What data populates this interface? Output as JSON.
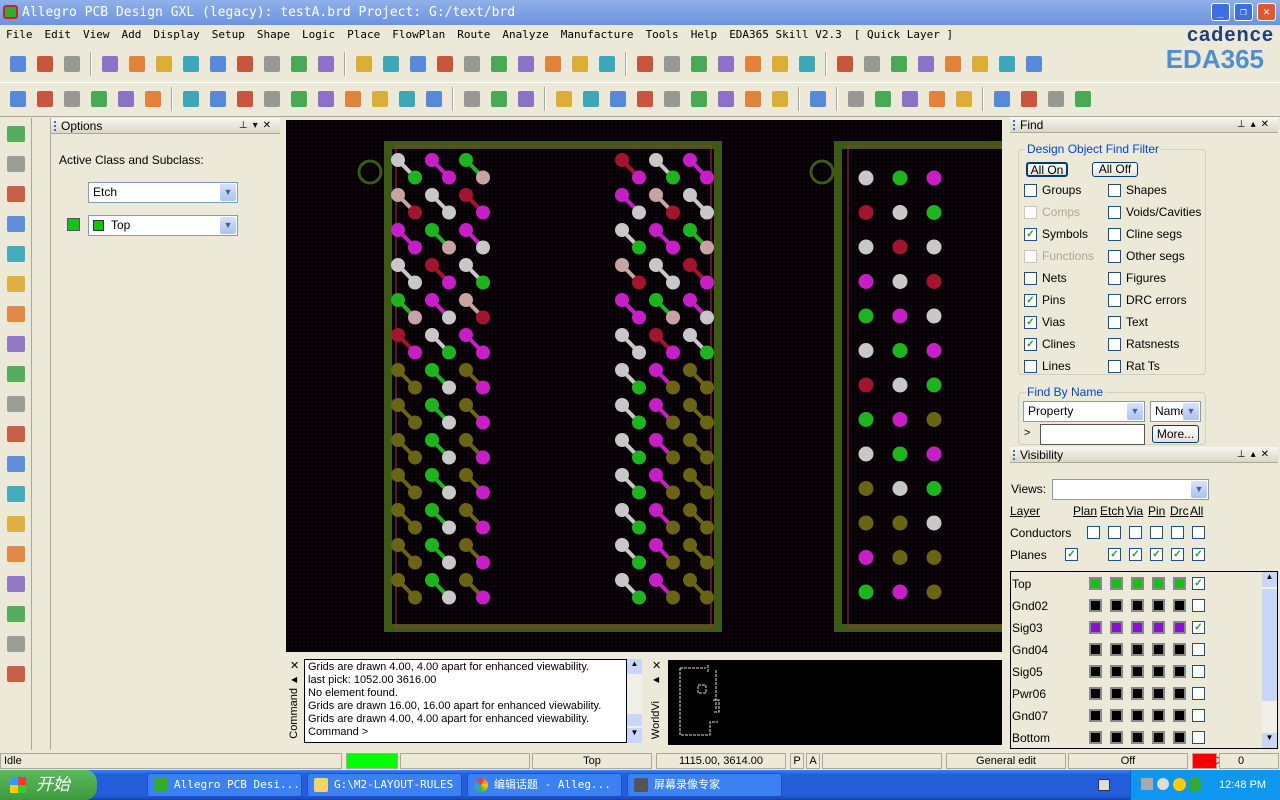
{
  "window": {
    "title": "Allegro PCB Design GXL (legacy): testA.brd  Project: G:/text/brd",
    "minimize": "_",
    "maximize": "❐",
    "close": "✕"
  },
  "brand": {
    "line1": "cadence",
    "line2": "EDA365"
  },
  "menu": [
    "File",
    "Edit",
    "View",
    "Add",
    "Display",
    "Setup",
    "Shape",
    "Logic",
    "Place",
    "FlowPlan",
    "Route",
    "Analyze",
    "Manufacture",
    "Tools",
    "Help",
    "EDA365 Skill V2.3",
    "[ Quick Layer ]"
  ],
  "toolbar1": [
    "new-icon",
    "open-icon",
    "save-icon",
    "|",
    "move-icon",
    "copy-icon",
    "delete-icon",
    "undo-icon",
    "down-arrow-icon",
    "redo-icon",
    "down-arrow-icon",
    "ratsnest-icon",
    "pin-icon",
    "|",
    "grid-icon",
    "zoom-fit-icon",
    "zoom-window-icon",
    "zoom-in-icon",
    "zoom-out-icon",
    "zoom-prev-icon",
    "zoom-world-icon",
    "refresh-icon",
    "3d-view-icon",
    "flip-icon",
    "|",
    "grid-toggle-icon",
    "color-icon",
    "layer-icon",
    "stack-icon",
    "ecset-icon",
    "dfa-icon",
    "spread-icon",
    "|",
    "info-icon",
    "property-icon",
    "measure-icon",
    "highlight-icon",
    "sun-icon",
    "dehighlight-icon",
    "report-icon",
    "erase-icon"
  ],
  "toolbar2": [
    "place-icon-1",
    "place-icon-2",
    "place-icon-3",
    "place-icon-4",
    "place-icon-5",
    "place-icon-6",
    "|",
    "add-connect-icon",
    "rect-icon",
    "circle-icon",
    "select-icon",
    "shape-icon",
    "arc-icon",
    "square-icon",
    "circle2-icon",
    "void-icon",
    "shape-edit-icon",
    "|",
    "component-icon",
    "dimension-icon",
    "dim2-icon",
    "|",
    "odb-icon",
    "film-icon",
    "mfg-icon",
    "camera-icon",
    "refdes-icon",
    "legend-icon",
    "drill-icon",
    "dimension3-icon",
    "array-icon",
    "|",
    "route-icon",
    "|",
    "doc1-icon",
    "doc2-icon",
    "doc3-icon",
    "check-icon",
    "wand-icon",
    "|",
    "window-icon",
    "shape-fill-icon",
    "mail-icon",
    "help-icon"
  ],
  "lefttools": [
    "place-manual-icon",
    "place-refdes-icon",
    "swap-icon",
    "add-connect-icon",
    "slide-icon",
    "delay-tune-icon",
    "custom-smooth-icon",
    "vertex-icon",
    "bus-route-icon",
    "fanout-icon",
    "spread-icon",
    "add-line-icon",
    "add-rect-icon",
    "add-text-icon",
    "edit-text-icon",
    "via-route-icon",
    "route-2-icon",
    "delete-route-icon",
    "cleanup-icon"
  ],
  "options": {
    "title": "Options",
    "label": "Active Class and Subclass:",
    "class_value": "Etch",
    "subclass_value": "Top",
    "subclass_color": "#12c412"
  },
  "console": {
    "tab": "Command",
    "lines": [
      "Grids are drawn 4.00, 4.00 apart for enhanced viewability.",
      "last pick:  1052.00  3616.00",
      "No element found.",
      "Grids are drawn 16.00, 16.00 apart for enhanced viewability.",
      "Grids are drawn 4.00, 4.00 apart for enhanced viewability.",
      "Command >"
    ]
  },
  "worldview": {
    "tab": "WorldVi"
  },
  "find": {
    "title": "Find",
    "filter_legend": "Design Object Find Filter",
    "all_on": "All On",
    "all_off": "All Off",
    "left": [
      {
        "label": "Groups",
        "checked": false,
        "disabled": false
      },
      {
        "label": "Comps",
        "checked": false,
        "disabled": true
      },
      {
        "label": "Symbols",
        "checked": true,
        "disabled": false
      },
      {
        "label": "Functions",
        "checked": false,
        "disabled": true
      },
      {
        "label": "Nets",
        "checked": false,
        "disabled": false
      },
      {
        "label": "Pins",
        "checked": true,
        "disabled": false
      },
      {
        "label": "Vias",
        "checked": true,
        "disabled": false
      },
      {
        "label": "Clines",
        "checked": true,
        "disabled": false
      },
      {
        "label": "Lines",
        "checked": false,
        "disabled": false
      }
    ],
    "right": [
      {
        "label": "Shapes",
        "checked": false
      },
      {
        "label": "Voids/Cavities",
        "checked": false
      },
      {
        "label": "Cline segs",
        "checked": false
      },
      {
        "label": "Other segs",
        "checked": false
      },
      {
        "label": "Figures",
        "checked": false
      },
      {
        "label": "DRC errors",
        "checked": false
      },
      {
        "label": "Text",
        "checked": false
      },
      {
        "label": "Ratsnests",
        "checked": false
      },
      {
        "label": "Rat Ts",
        "checked": false
      }
    ],
    "byname_legend": "Find By Name",
    "type_value": "Property",
    "name_value": "Name",
    "prompt": ">",
    "input_value": "",
    "more": "More..."
  },
  "visibility": {
    "title": "Visibility",
    "views_label": "Views:",
    "views_value": "",
    "headers": [
      "Layer",
      "Plan",
      "Etch",
      "Via",
      "Pin",
      "Drc",
      "All"
    ],
    "conductors": {
      "label": "Conductors",
      "checks": [
        false,
        false,
        false,
        false,
        false,
        false
      ]
    },
    "planes": {
      "label": "Planes",
      "checks": [
        true,
        null,
        true,
        true,
        true,
        true,
        true
      ]
    },
    "layers": [
      {
        "name": "Top",
        "color": "#12c412",
        "all": true
      },
      {
        "name": "Gnd02",
        "color": "#000000",
        "all": false
      },
      {
        "name": "Sig03",
        "color": "#8a10d0",
        "all": true
      },
      {
        "name": "Gnd04",
        "color": "#000000",
        "all": false
      },
      {
        "name": "Sig05",
        "color": "#000000",
        "all": false
      },
      {
        "name": "Pwr06",
        "color": "#000000",
        "all": false
      },
      {
        "name": "Gnd07",
        "color": "#000000",
        "all": false
      },
      {
        "name": "Bottom",
        "color": "#000000",
        "all": false
      }
    ]
  },
  "status": {
    "state": "Idle",
    "layer": "Top",
    "coords": "1115.00, 3614.00",
    "p": "P",
    "a": "A",
    "mode": "General edit",
    "off": "Off",
    "drc": "DRC",
    "count": "0",
    "indicator_color": "#00ff00",
    "drc_color": "#ff0000"
  },
  "taskbar": {
    "start": "开始",
    "tasks": [
      "Allegro PCB Desi...",
      "G:\\M2-LAYOUT-RULES",
      "编辑话题 - Alleg...",
      "屏幕录像专家"
    ],
    "time": "12:48 PM"
  },
  "pad_colors": {
    "white": "#c8c8c8",
    "magenta": "#c81ec8",
    "red": "#a3142e",
    "green": "#1eb41e",
    "olive": "#6b6414",
    "pink": "#c8a3a3",
    "outline": "#3c5a14",
    "bound": "#b42850"
  }
}
